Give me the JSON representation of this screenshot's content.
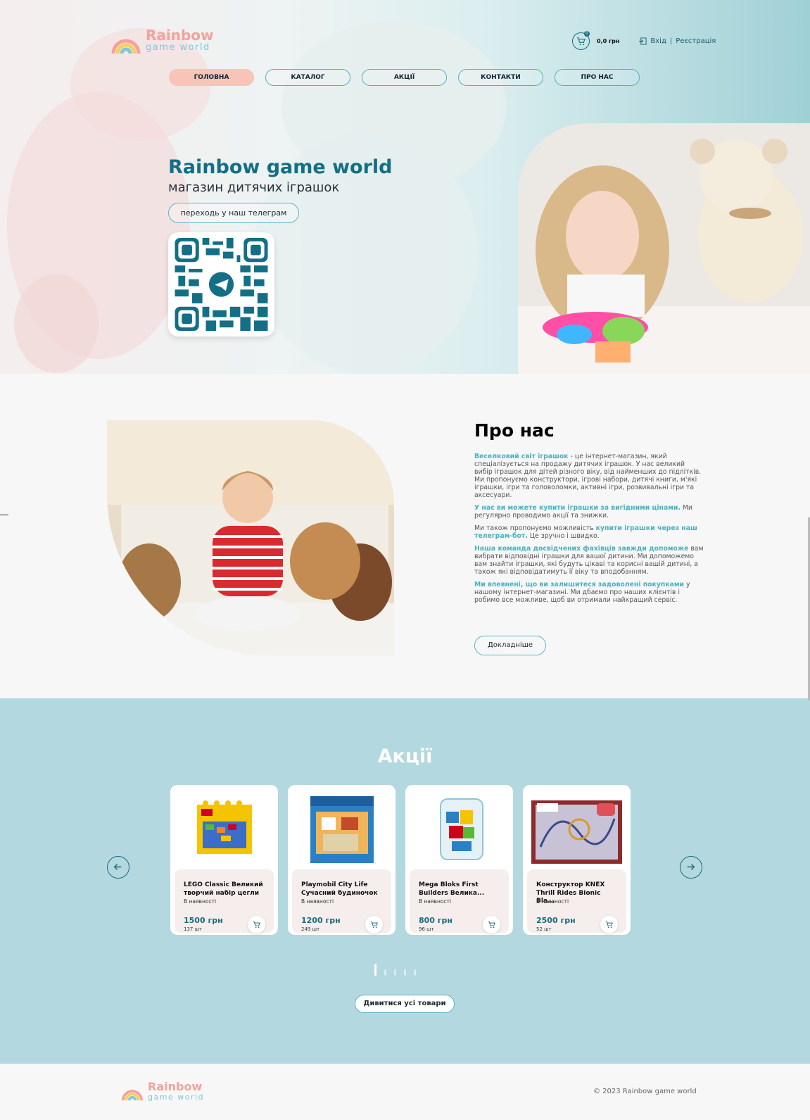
{
  "header": {
    "logo_line1": "Rainbow",
    "logo_line2": "game world",
    "cart_count": "0",
    "cart_total": "0,0 грн",
    "login": "Вхід",
    "separator": "|",
    "register": "Реєстрація"
  },
  "nav": [
    {
      "label": "ГОЛОВНА",
      "active": true
    },
    {
      "label": "КАТАЛОГ"
    },
    {
      "label": "АКЦІЇ"
    },
    {
      "label": "КОНТАКТИ"
    },
    {
      "label": "ПРО НАС"
    }
  ],
  "hero": {
    "title": "Rainbow game world",
    "subtitle": "магазин дитячих іграшок",
    "telegram_button": "переходь у наш телеграм"
  },
  "about": {
    "title": "Про нас",
    "p1_hl": "Веселковий світ іграшок",
    "p1": " - це інтернет-магазин, який спеціалізується на продажу дитячих іграшок. У нас великий вибір іграшок для дітей різного віку, від найменших до підлітків. Ми пропонуємо конструктори, ігрові набори, дитячі книги, м'які іграшки, ігри та головоломки, активні ігри, розвивальні ігри та аксесуари.",
    "p2_hl": "У нас ви можете купити іграшки за вигідними цінами.",
    "p2": " Ми регулярно проводимо акції та знижки.",
    "p3_pre": "Ми також пропонуємо можливість ",
    "p3_hl": "купити іграшки через наш телеграм-бот.",
    "p3": " Це зручно і швидко.",
    "p4_hl": "Наша команда досвідчених фахівців завжди допоможе",
    "p4": " вам вибрати відповідні іграшки для вашої дитини. Ми допоможемо вам знайти іграшки, які будуть цікаві та корисні вашій дитині, а також які відповідатимуть її віку та вподобанням.",
    "p5_hl": "Ми впевнені, що ви залишитеся задоволені покупками",
    "p5": " у нашому інтернет-магазині. Ми дбаємо про наших клієнтів і робимо все можливе, щоб ви отримали найкращий сервіс.",
    "more_button": "Докладніше"
  },
  "promo": {
    "title": "Акції",
    "all_button": "Дивитися усі товари",
    "products": [
      {
        "name": "LEGO Classic Великий творчий набір цегли",
        "availability": "В наявності",
        "price": "1500 грн",
        "qty": "137 шт"
      },
      {
        "name": "Playmobil City Life Сучасний будиночок",
        "availability": "В наявності",
        "price": "1200 грн",
        "qty": "249 шт"
      },
      {
        "name": "Mega Bloks First Builders Велика...",
        "availability": "В наявності",
        "price": "800 грн",
        "qty": "96 шт"
      },
      {
        "name": "Конструктор KNEX Thrill Rides Bionic Bla...",
        "availability": "В наявності",
        "price": "2500 грн",
        "qty": "52 шт"
      }
    ]
  },
  "footer": {
    "copyright": "© 2023 Rainbow game world"
  },
  "colors": {
    "accent": "#1b6b80",
    "highlight": "#46b3c2",
    "active_nav": "#f7c4b7",
    "promo_bg": "#b3d8df"
  }
}
